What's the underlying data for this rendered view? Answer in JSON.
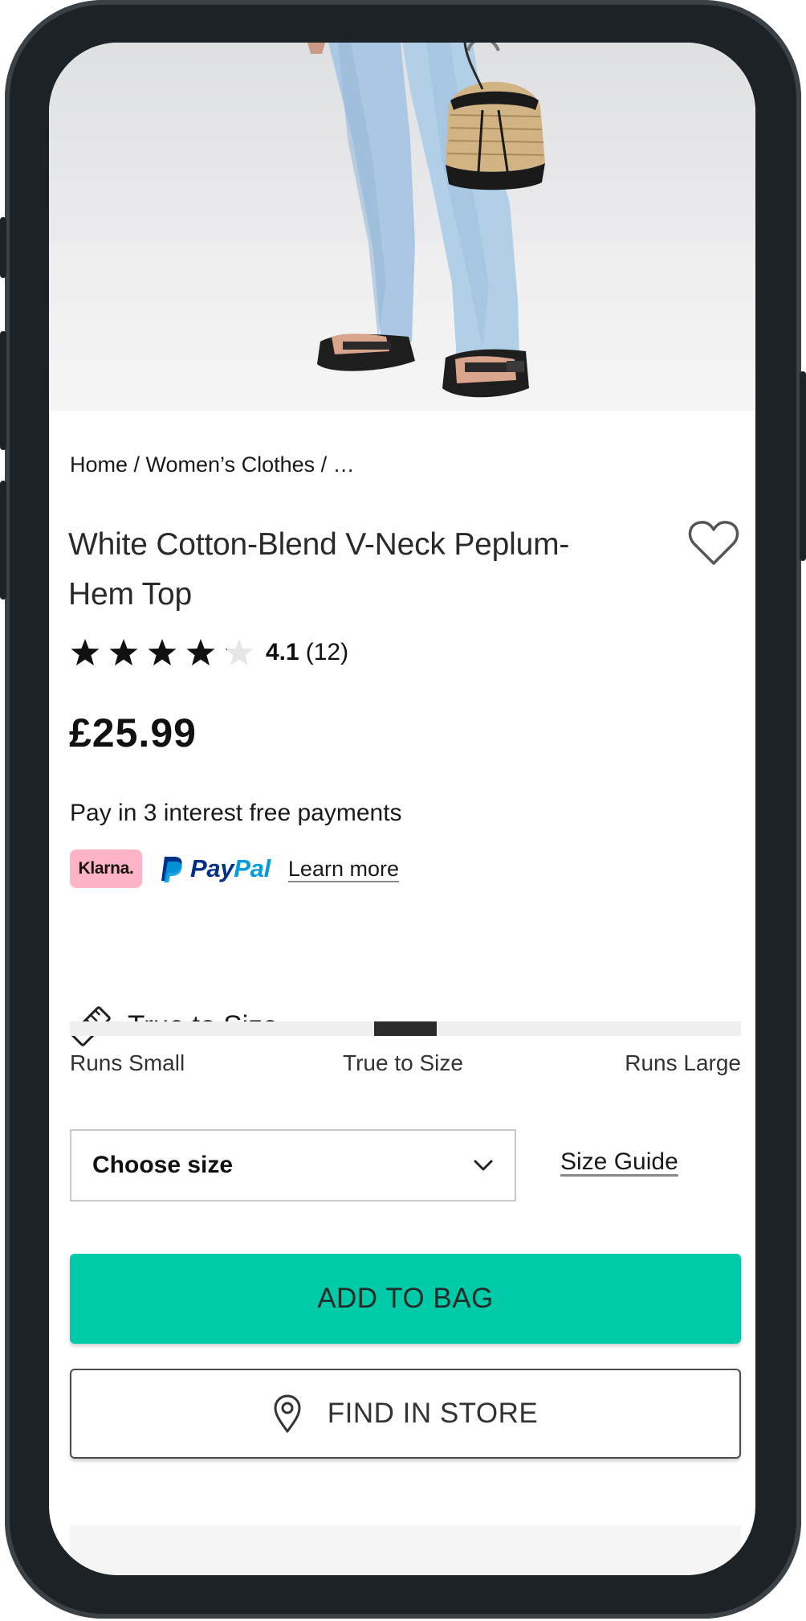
{
  "breadcrumb": "Home / Women’s Clothes / …",
  "product": {
    "title": "White Cotton-Blend V-Neck Peplum-Hem Top",
    "rating_value": "4.1",
    "rating_count": "(12)",
    "rating_stars": 4.1,
    "price": "£25.99"
  },
  "payments": {
    "text": "Pay in 3 interest free payments",
    "klarna_label": "Klarna.",
    "paypal_label_1": "Pay",
    "paypal_label_2": "Pal",
    "learn_more": "Learn more"
  },
  "fit": {
    "heading": "True to Size",
    "position": 0.5,
    "labels": {
      "small": "Runs Small",
      "true": "True to Size",
      "large": "Runs Large"
    }
  },
  "size": {
    "select_label": "Choose size",
    "guide": "Size Guide"
  },
  "actions": {
    "add_to_bag": "ADD TO BAG",
    "find_in_store": "FIND IN STORE"
  },
  "colors": {
    "accent": "#00cba9",
    "klarna": "#ffb3c7",
    "paypal_dark": "#003087",
    "paypal_light": "#009cde"
  },
  "icons": {
    "wishlist": "heart-outline-icon",
    "fit": "ruler-icon",
    "select": "chevron-down-icon",
    "store": "location-pin-icon"
  }
}
